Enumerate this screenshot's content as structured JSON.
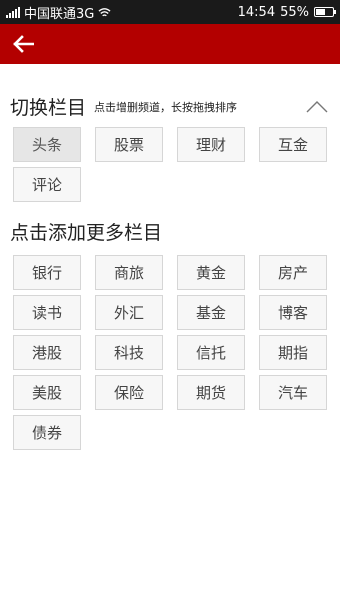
{
  "status_bar": {
    "carrier": "中国联通3G",
    "time": "14:54",
    "battery": "55%",
    "battery_level": 0.55
  },
  "header": {
    "back_icon": "arrow-left-icon",
    "background_color": "#b30000"
  },
  "my_channels": {
    "title": "切换栏目",
    "hint": "点击增删频道，长按拖拽排序",
    "collapse_icon": "chevron-up-icon",
    "items": [
      "头条",
      "股票",
      "理财",
      "互金",
      "评论"
    ],
    "active_index": 0
  },
  "more_channels": {
    "title": "点击添加更多栏目",
    "items": [
      "银行",
      "商旅",
      "黄金",
      "房产",
      "读书",
      "外汇",
      "基金",
      "博客",
      "港股",
      "科技",
      "信托",
      "期指",
      "美股",
      "保险",
      "期货",
      "汽车",
      "债券"
    ]
  }
}
